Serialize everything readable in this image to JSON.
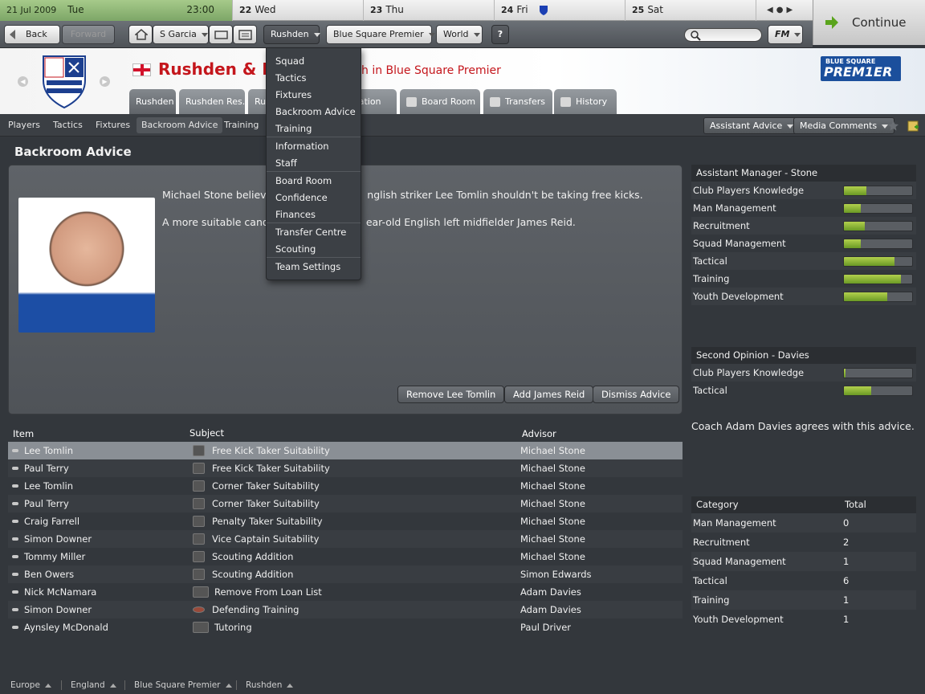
{
  "calendar": {
    "days": [
      {
        "num": "21 Jul 2009",
        "name": "Tue",
        "time": "23:00"
      },
      {
        "num": "22",
        "name": "Wed"
      },
      {
        "num": "23",
        "name": "Thu"
      },
      {
        "num": "24",
        "name": "Fri"
      },
      {
        "num": "25",
        "name": "Sat"
      }
    ]
  },
  "continue_label": "Continue",
  "nav": {
    "back": "Back",
    "forward": "Forward",
    "manager": "S Garcia",
    "club": "Rushden",
    "league": "Blue Square Premier",
    "world": "World",
    "help": "?",
    "fm": "FM"
  },
  "header": {
    "club_name": "Rushden & D",
    "subtitle": "h in Blue Square Premier",
    "logo_line1": "BLUE SQUARE",
    "logo_line2": "PREM1ER"
  },
  "tabs": [
    {
      "label": "Rushden"
    },
    {
      "label": "Rushden Res."
    },
    {
      "label": "Ru"
    },
    {
      "label": "mation"
    },
    {
      "label": "Board Room"
    },
    {
      "label": "Transfers"
    },
    {
      "label": "History"
    }
  ],
  "subtabs": [
    "Players",
    "Tactics",
    "Fixtures",
    "Backroom Advice",
    "Training"
  ],
  "subbar_buttons": {
    "assistant": "Assistant Advice",
    "media": "Media Comments"
  },
  "page_title": "Backroom Advice",
  "advice": {
    "line1": "Michael Stone believe",
    "line1b": "nglish striker Lee Tomlin shouldn't be taking free kicks.",
    "line2": "A more suitable cand",
    "line2b": "ear-old English left midfielder James Reid.",
    "buttons": [
      "Remove Lee Tomlin",
      "Add James Reid",
      "Dismiss Advice"
    ]
  },
  "club_menu": {
    "items": [
      "Squad",
      "Tactics",
      "Fixtures",
      "Backroom Advice",
      "Training",
      "Information",
      "Staff",
      "Board Room",
      "Confidence",
      "Finances",
      "Transfer Centre",
      "Scouting",
      "Team Settings"
    ]
  },
  "table": {
    "headers": [
      "Item",
      "Subject",
      "Advisor"
    ],
    "rows": [
      {
        "item": "Lee Tomlin",
        "subject": "Free Kick Taker Suitability",
        "advisor": "Michael Stone",
        "icon": "set-piece-icon"
      },
      {
        "item": "Paul Terry",
        "subject": "Free Kick Taker Suitability",
        "advisor": "Michael Stone",
        "icon": "set-piece-icon"
      },
      {
        "item": "Lee Tomlin",
        "subject": "Corner Taker Suitability",
        "advisor": "Michael Stone",
        "icon": "set-piece-icon"
      },
      {
        "item": "Paul Terry",
        "subject": "Corner Taker Suitability",
        "advisor": "Michael Stone",
        "icon": "set-piece-icon"
      },
      {
        "item": "Craig Farrell",
        "subject": "Penalty Taker Suitability",
        "advisor": "Michael Stone",
        "icon": "set-piece-icon"
      },
      {
        "item": "Simon Downer",
        "subject": "Vice Captain Suitability",
        "advisor": "Michael Stone",
        "icon": "set-piece-icon"
      },
      {
        "item": "Tommy Miller",
        "subject": "Scouting Addition",
        "advisor": "Michael Stone",
        "icon": "magnifier-icon"
      },
      {
        "item": "Ben Owers",
        "subject": "Scouting Addition",
        "advisor": "Simon Edwards",
        "icon": "magnifier-icon"
      },
      {
        "item": "Nick McNamara",
        "subject": "Remove From Loan List",
        "advisor": "Adam Davies",
        "icon": "group-icon"
      },
      {
        "item": "Simon Downer",
        "subject": "Defending Training",
        "advisor": "Adam Davies",
        "icon": "training-icon"
      },
      {
        "item": "Aynsley McDonald",
        "subject": "Tutoring",
        "advisor": "Paul Driver",
        "icon": "group-icon"
      }
    ]
  },
  "assistant": {
    "title": "Assistant Manager - Stone",
    "ratings": [
      {
        "label": "Club Players Knowledge",
        "level": 0.33
      },
      {
        "label": "Man Management",
        "level": 0.25
      },
      {
        "label": "Recruitment",
        "level": 0.3
      },
      {
        "label": "Squad Management",
        "level": 0.25
      },
      {
        "label": "Tactical",
        "level": 0.74
      },
      {
        "label": "Training",
        "level": 0.84
      },
      {
        "label": "Youth Development",
        "level": 0.64
      }
    ]
  },
  "second_opinion": {
    "title": "Second Opinion - Davies",
    "ratings": [
      {
        "label": "Club Players Knowledge",
        "level": 0.02
      },
      {
        "label": "Tactical",
        "level": 0.4
      }
    ]
  },
  "agree_text": "Coach Adam Davies agrees with this advice.",
  "categories": {
    "headers": [
      "Category",
      "Total"
    ],
    "rows": [
      {
        "label": "Man Management",
        "total": "0"
      },
      {
        "label": "Recruitment",
        "total": "2"
      },
      {
        "label": "Squad Management",
        "total": "1"
      },
      {
        "label": "Tactical",
        "total": "6"
      },
      {
        "label": "Training",
        "total": "1"
      },
      {
        "label": "Youth Development",
        "total": "1"
      }
    ]
  },
  "footer": [
    "Europe",
    "England",
    "Blue Square Premier",
    "Rushden"
  ],
  "colors": {
    "accent_red": "#c4161c",
    "bar_green": "#8bb53a",
    "panel": "#33373c"
  }
}
